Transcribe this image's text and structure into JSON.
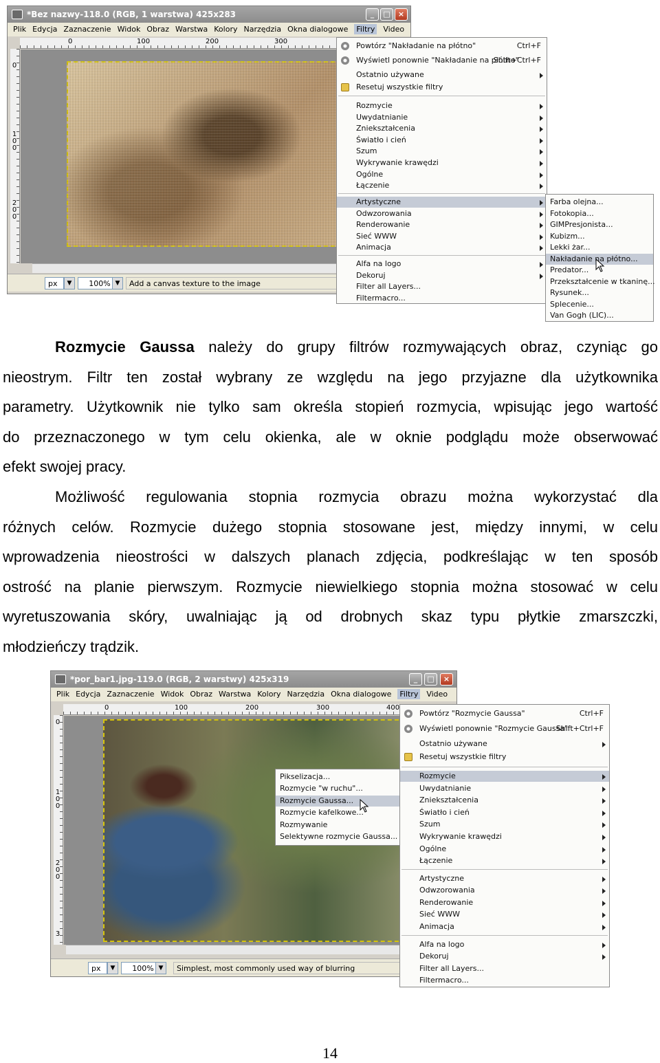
{
  "screenshot1": {
    "title": "*Bez nazwy-118.0 (RGB, 1 warstwa) 425x283",
    "menubar": [
      "Plik",
      "Edycja",
      "Zaznaczenie",
      "Widok",
      "Obraz",
      "Warstwa",
      "Kolory",
      "Narzędzia",
      "Okna dialogowe",
      "Filtry",
      "Video"
    ],
    "ruler_h": [
      "0",
      "100",
      "200",
      "300"
    ],
    "ruler_v": [
      [
        "0"
      ],
      [
        "1",
        "0",
        "0"
      ],
      [
        "2",
        "0",
        "0"
      ]
    ],
    "status": {
      "unit": "px",
      "zoom": "100%",
      "message": "Add a canvas texture to the image"
    },
    "filters_menu": [
      {
        "label": "Powtórz \"Nakładanie na płótno\"",
        "shortcut": "Ctrl+F",
        "icon": "gear-icon"
      },
      {
        "label": "Wyświetl ponownie \"Nakładanie na płótno\"",
        "shortcut": "Shift+Ctrl+F",
        "icon": "gear-icon"
      },
      {
        "label": "Ostatnio używane",
        "submenu": true
      },
      {
        "label": "Resetuj wszystkie filtry",
        "icon": "reset-icon"
      },
      {
        "label": "Rozmycie",
        "submenu": true
      },
      {
        "label": "Uwydatnianie",
        "submenu": true
      },
      {
        "label": "Zniekształcenia",
        "submenu": true
      },
      {
        "label": "Światło i cień",
        "submenu": true
      },
      {
        "label": "Szum",
        "submenu": true
      },
      {
        "label": "Wykrywanie krawędzi",
        "submenu": true
      },
      {
        "label": "Ogólne",
        "submenu": true
      },
      {
        "label": "Łączenie",
        "submenu": true
      },
      {
        "label": "Artystyczne",
        "submenu": true
      },
      {
        "label": "Odwzorowania",
        "submenu": true
      },
      {
        "label": "Renderowanie",
        "submenu": true
      },
      {
        "label": "Sieć WWW",
        "submenu": true
      },
      {
        "label": "Animacja",
        "submenu": true
      },
      {
        "label": "Alfa na logo",
        "submenu": true
      },
      {
        "label": "Dekoruj",
        "submenu": true
      },
      {
        "label": "Filter all Layers..."
      },
      {
        "label": "Filtermacro..."
      }
    ],
    "artistic_submenu": [
      "Farba olejna...",
      "Fotokopia...",
      "GIMPresjonista...",
      "Kubizm...",
      "Lekki żar...",
      "Nakładanie na płótno...",
      "Predator...",
      "Przekształcenie w tkaninę...",
      "Rysunek...",
      "Splecenie...",
      "Van Gogh (LIC)..."
    ]
  },
  "paragraph1": {
    "bold_lead": "Rozmycie Gaussa",
    "lines": [
      " należy do grupy filtrów rozmywających obraz, czyniąc go",
      "nieostrym. Filtr ten został wybrany ze względu na jego przyjazne dla użytkownika",
      "parametry. Użytkownik nie tylko sam określa stopień rozmycia, wpisując jego wartość",
      "do przeznaczonego w tym celu okienka, ale w oknie podglądu może obserwować",
      "efekt swojej pracy."
    ]
  },
  "paragraph2": {
    "lines": [
      "Możliwość regulowania stopnia rozmycia obrazu można wykorzystać dla",
      "różnych celów. Rozmycie dużego stopnia stosowane jest, między innymi, w celu",
      "wprowadzenia nieostrości w dalszych planach zdjęcia, podkreślając w ten sposób",
      "ostrość na planie pierwszym. Rozmycie niewielkiego stopnia można stosować w celu",
      "wyretuszowania skóry, uwalniając ją od drobnych skaz typu płytkie zmarszczki,",
      "młodzieńczy trądzik."
    ]
  },
  "screenshot2": {
    "title": "*por_bar1.jpg-119.0 (RGB, 2 warstwy) 425x319",
    "menubar": [
      "Plik",
      "Edycja",
      "Zaznaczenie",
      "Widok",
      "Obraz",
      "Warstwa",
      "Kolory",
      "Narzędzia",
      "Okna dialogowe",
      "Filtry",
      "Video"
    ],
    "ruler_h": [
      "0",
      "100",
      "200",
      "300",
      "400"
    ],
    "ruler_v": [
      [
        "0"
      ],
      [
        "1",
        "0",
        "0"
      ],
      [
        "2",
        "0",
        "0"
      ],
      [
        "3"
      ]
    ],
    "status": {
      "unit": "px",
      "zoom": "100%",
      "message": "Simplest, most commonly used way of blurring"
    },
    "filters_menu": [
      {
        "label": "Powtórz \"Rozmycie Gaussa\"",
        "shortcut": "Ctrl+F",
        "icon": "gear-icon"
      },
      {
        "label": "Wyświetl ponownie \"Rozmycie Gaussa\"",
        "shortcut": "Shift+Ctrl+F",
        "icon": "gear-icon"
      },
      {
        "label": "Ostatnio używane",
        "submenu": true
      },
      {
        "label": "Resetuj wszystkie filtry",
        "icon": "reset-icon"
      },
      {
        "label": "Rozmycie",
        "submenu": true
      },
      {
        "label": "Uwydatnianie",
        "submenu": true
      },
      {
        "label": "Zniekształcenia",
        "submenu": true
      },
      {
        "label": "Światło i cień",
        "submenu": true
      },
      {
        "label": "Szum",
        "submenu": true
      },
      {
        "label": "Wykrywanie krawędzi",
        "submenu": true
      },
      {
        "label": "Ogólne",
        "submenu": true
      },
      {
        "label": "Łączenie",
        "submenu": true
      },
      {
        "label": "Artystyczne",
        "submenu": true
      },
      {
        "label": "Odwzorowania",
        "submenu": true
      },
      {
        "label": "Renderowanie",
        "submenu": true
      },
      {
        "label": "Sieć WWW",
        "submenu": true
      },
      {
        "label": "Animacja",
        "submenu": true
      },
      {
        "label": "Alfa na logo",
        "submenu": true
      },
      {
        "label": "Dekoruj",
        "submenu": true
      },
      {
        "label": "Filter all Layers..."
      },
      {
        "label": "Filtermacro..."
      }
    ],
    "blur_submenu": [
      "Pikselizacja...",
      "Rozmycie \"w ruchu\"...",
      "Rozmycie Gaussa...",
      "Rozmycie kafelkowe...",
      "Rozmywanie",
      "Selektywne rozmycie Gaussa..."
    ]
  },
  "page_number": "14"
}
